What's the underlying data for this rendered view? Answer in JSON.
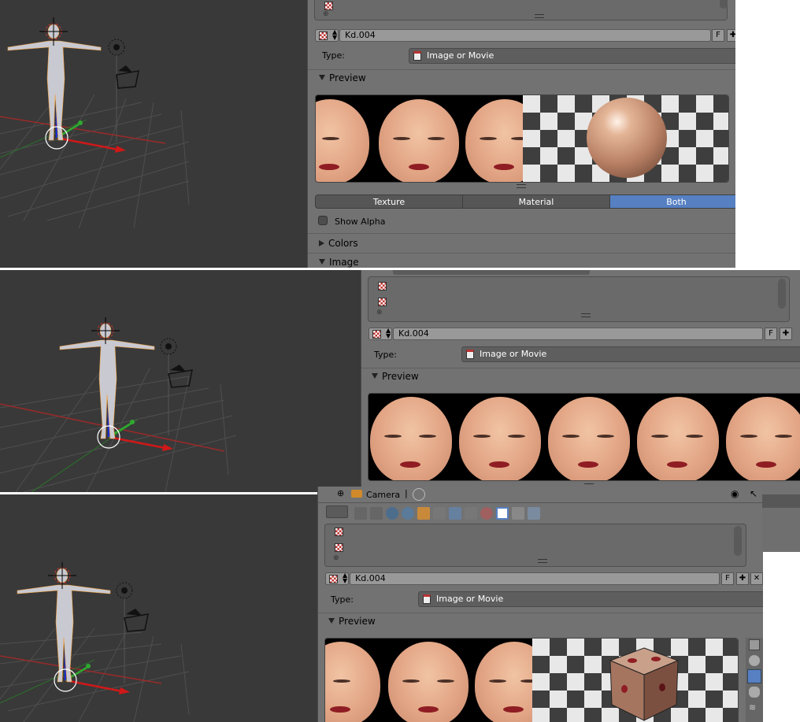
{
  "shot1": {
    "texture_name": "Kd.004",
    "fake_user_btn": "F",
    "type_label": "Type:",
    "type_value": "Image or Movie",
    "preview_header": "Preview",
    "tabs": [
      "Texture",
      "Material",
      "Both"
    ],
    "active_tab": "Both",
    "show_alpha": "Show Alpha",
    "colors_header": "Colors",
    "image_header": "Image"
  },
  "shot2": {
    "texture_name": "Kd.004",
    "fake_user_btn": "F",
    "type_label": "Type:",
    "type_value": "Image or Movie",
    "preview_header": "Preview"
  },
  "shot3": {
    "header_camera": "Camera",
    "texture_name": "Kd.004",
    "fake_user_btn": "F",
    "type_label": "Type:",
    "type_value": "Image or Movie",
    "preview_header": "Preview"
  },
  "icons": {
    "texture": "checker-texture-icon",
    "add": "plus-icon",
    "close": "x-icon",
    "eye": "eye-icon",
    "cursor": "cursor-icon",
    "camera": "camera-icon"
  },
  "colors": {
    "viewport_bg": "#393939",
    "panel_bg": "#727272",
    "active_tab": "#5680c2",
    "x_axis": "#d01818",
    "y_axis": "#2fa82f",
    "z_axis": "#1a2fd0"
  }
}
